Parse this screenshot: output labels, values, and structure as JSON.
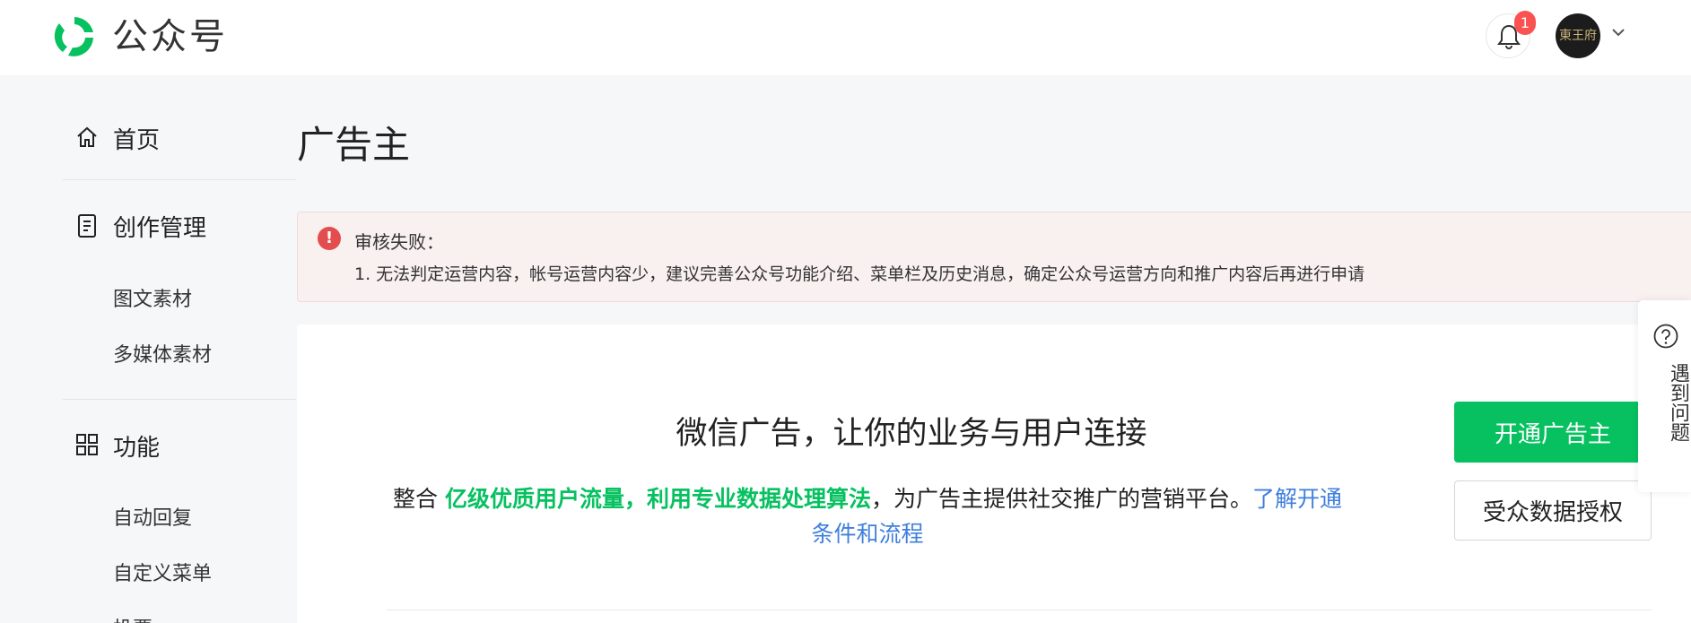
{
  "header": {
    "brand": "公众号",
    "notification_count": "1",
    "avatar_text": "東王府"
  },
  "sidebar": {
    "home": "首页",
    "creation": "创作管理",
    "creation_items": [
      "图文素材",
      "多媒体素材"
    ],
    "features": "功能",
    "feature_items": [
      "自动回复",
      "自定义菜单",
      "投票"
    ]
  },
  "page": {
    "title": "广告主"
  },
  "alert": {
    "title": "审核失败：",
    "message": "1. 无法判定运营内容，帐号运营内容少，建议完善公众号功能介绍、菜单栏及历史消息，确定公众号运营方向和推广内容后再进行申请"
  },
  "card": {
    "headline": "微信广告，让你的业务与用户连接",
    "desc_prefix": "整合 ",
    "desc_highlight": "亿级优质用户流量，利用专业数据处理算法",
    "desc_middle": "，为广告主提供社交推广的营销平台。",
    "desc_link": "了解开通条件和流程"
  },
  "actions": {
    "open_advertiser": "开通广告主",
    "audience_auth": "受众数据授权"
  },
  "help": {
    "label": "遇到问题"
  },
  "colors": {
    "accent": "#07c160",
    "link": "#3f7fdd",
    "error": "#e34d4d",
    "badge": "#fa5151"
  }
}
